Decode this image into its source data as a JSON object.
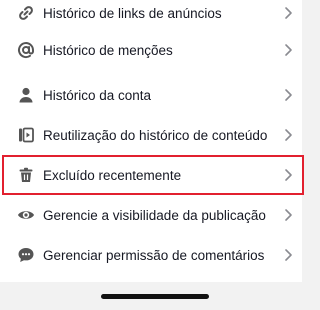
{
  "menu": {
    "items": [
      {
        "label": "Histórico de links de anúncios",
        "icon": "link-icon"
      },
      {
        "label": "Histórico de menções",
        "icon": "at-sign-icon"
      },
      {
        "label": "Histórico da conta",
        "icon": "person-icon"
      },
      {
        "label": "Reutilização do histórico de conteúdo",
        "icon": "video-reuse-icon"
      },
      {
        "label": "Excluído recentemente",
        "icon": "trash-icon",
        "highlighted": true
      },
      {
        "label": "Gerencie a visibilidade da publicação",
        "icon": "eye-icon"
      },
      {
        "label": "Gerenciar permissão de comentários",
        "icon": "comment-bubble-icon"
      }
    ]
  },
  "colors": {
    "text": "#161823",
    "icon": "#555555",
    "chevron": "#8a8b91",
    "highlight": "#e2202f",
    "background": "#f2f2f2",
    "card": "#ffffff"
  }
}
